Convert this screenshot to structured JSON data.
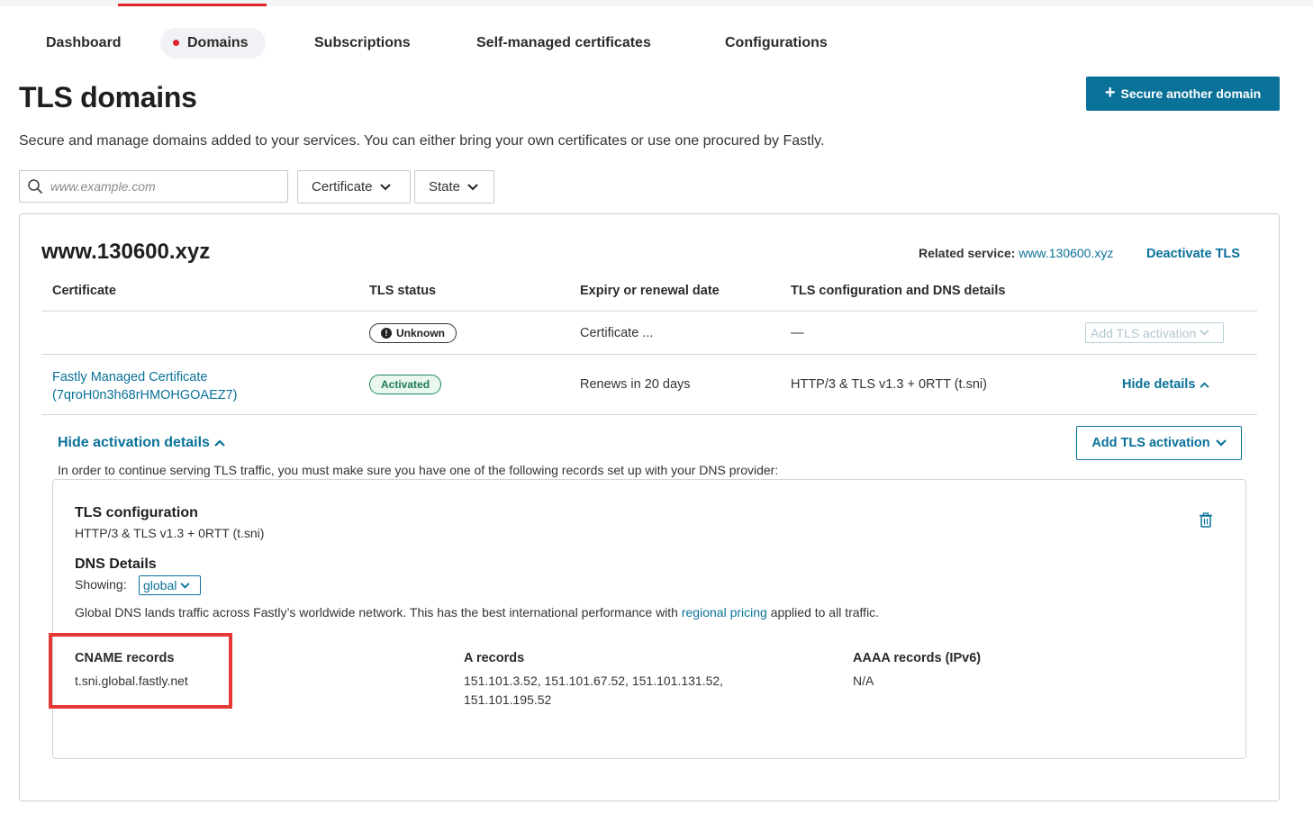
{
  "nav": {
    "tabs": [
      {
        "label": "Dashboard",
        "active": false
      },
      {
        "label": "Domains",
        "active": true
      },
      {
        "label": "Subscriptions",
        "active": false
      },
      {
        "label": "Self-managed certificates",
        "active": false
      },
      {
        "label": "Configurations",
        "active": false
      }
    ]
  },
  "header": {
    "title": "TLS domains",
    "primary_button": "Secure another domain",
    "subtitle": "Secure and manage domains added to your services. You can either bring your own certificates or use one procured by Fastly."
  },
  "filters": {
    "search_placeholder": "www.example.com",
    "certificate_label": "Certificate",
    "state_label": "State"
  },
  "domain_card": {
    "domain": "www.130600.xyz",
    "related_label": "Related service:",
    "related_value": "www.130600.xyz",
    "deactivate_label": "Deactivate TLS",
    "columns": [
      "Certificate",
      "TLS status",
      "Expiry or renewal date",
      "TLS configuration and DNS details"
    ],
    "rows": [
      {
        "certificate": "",
        "status": "Unknown",
        "expiry": "Certificate ...",
        "config": "—",
        "action": "Add TLS activation"
      },
      {
        "certificate_line1": "Fastly Managed Certificate",
        "certificate_line2": "(7qroH0n3h68rHMOHGOAEZ7)",
        "status": "Activated",
        "expiry": "Renews in 20 days",
        "config": "HTTP/3 & TLS v1.3 + 0RTT (t.sni)",
        "action": "Hide details"
      }
    ]
  },
  "activation": {
    "toggle_label": "Hide activation details",
    "add_button": "Add TLS activation",
    "note": "In order to continue serving TLS traffic, you must make sure you have one of the following records set up with your DNS provider:",
    "tls_heading": "TLS configuration",
    "tls_value": "HTTP/3 & TLS v1.3 + 0RTT (t.sni)",
    "dns_heading": "DNS Details",
    "showing_label": "Showing:",
    "showing_value": "global",
    "description_before": "Global DNS lands traffic across Fastly’s worldwide network. This has the best international performance with ",
    "description_link": "regional pricing",
    "description_after": " applied to all traffic.",
    "records": [
      {
        "heading": "CNAME records",
        "line1": "t.sni.global.fastly.net",
        "line2": ""
      },
      {
        "heading": "A records",
        "line1": "151.101.3.52, 151.101.67.52, 151.101.131.52,",
        "line2": "151.101.195.52"
      },
      {
        "heading": "AAAA records (IPv6)",
        "line1": "N/A",
        "line2": ""
      }
    ]
  },
  "colors": {
    "accent": "#0a7299",
    "brand_red": "#e0242a",
    "activated_green": "#1d8a5a",
    "highlight_red": "#e53935"
  }
}
